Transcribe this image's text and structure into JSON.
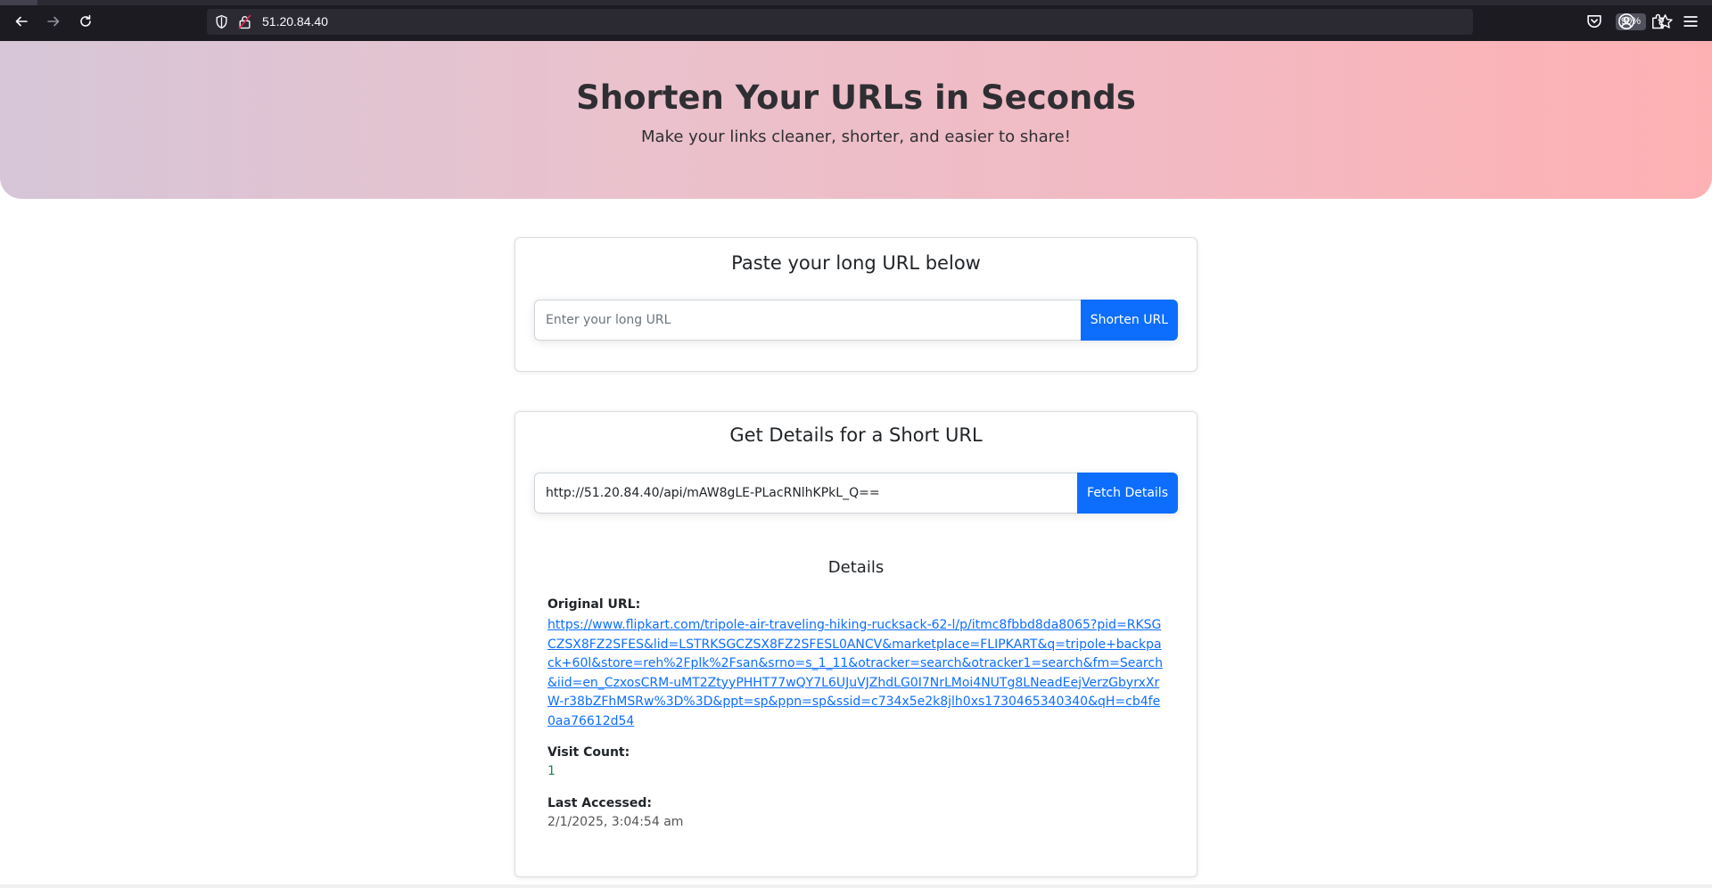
{
  "browser": {
    "url": "51.20.84.40",
    "zoom": "90%"
  },
  "hero": {
    "title": "Shorten Your URLs in Seconds",
    "subtitle": "Make your links cleaner, shorter, and easier to share!"
  },
  "shorten_card": {
    "title": "Paste your long URL below",
    "input_value": "",
    "input_placeholder": "Enter your long URL",
    "button_label": "Shorten URL"
  },
  "details_card": {
    "title": "Get Details for a Short URL",
    "input_value": "http://51.20.84.40/api/mAW8gLE-PLacRNlhKPkL_Q==",
    "button_label": "Fetch Details",
    "details_title": "Details",
    "original_url_label": "Original URL:",
    "original_url": "https://www.flipkart.com/tripole-air-traveling-hiking-rucksack-62-l/p/itmc8fbbd8da8065?pid=RKSGCZSX8FZ2SFES&lid=LSTRKSGCZSX8FZ2SFESL0ANCV&marketplace=FLIPKART&q=tripole+backpack+60l&store=reh%2Fplk%2Fsan&srno=s_1_11&otracker=search&otracker1=search&fm=Search&iid=en_CzxosCRM-uMT2ZtyyPHHT77wQY7L6UJuVJZhdLG0I7NrLMoi4NUTg8LNeadEejVerzGbyrxXrW-r38bZFhMSRw%3D%3D&ppt=sp&ppn=sp&ssid=c734x5e2k8jlh0xs1730465340340&qH=cb4fe0aa76612d54",
    "visit_count_label": "Visit Count:",
    "visit_count": "1",
    "last_accessed_label": "Last Accessed:",
    "last_accessed": "2/1/2025, 3:04:54 am"
  },
  "colors": {
    "primary_button": "#0d6efd",
    "link": "#0d6efd",
    "visit_count": "#198754"
  }
}
